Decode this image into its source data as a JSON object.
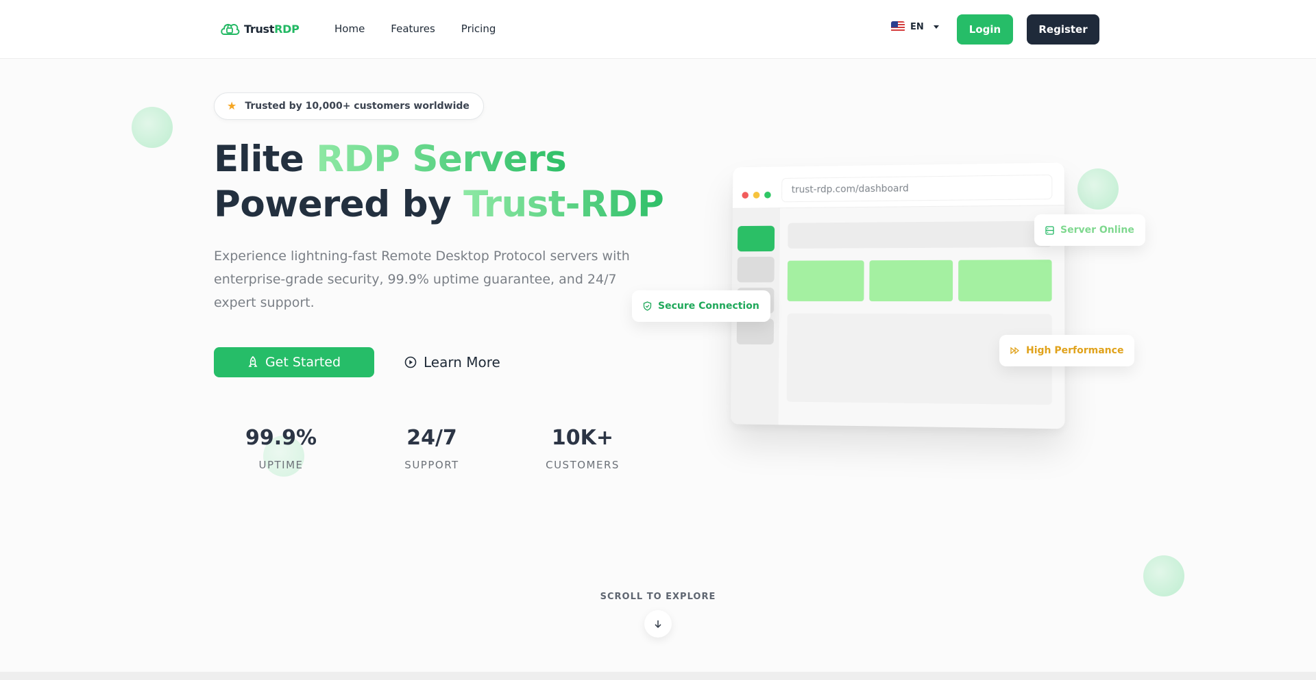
{
  "nav": {
    "logo": {
      "part1": "Trust",
      "part2": "RDP"
    },
    "links": [
      "Home",
      "Features",
      "Pricing"
    ],
    "language": {
      "code": "EN",
      "flag_icon": "us-flag-icon"
    },
    "login_label": "Login",
    "register_label": "Register"
  },
  "hero": {
    "badge": "Trusted by 10,000+ customers worldwide",
    "title": {
      "line1_plain": "Elite ",
      "line1_accent": "RDP Servers",
      "line2_plain": "Powered by ",
      "line2_accent": "Trust-RDP"
    },
    "subtitle": "Experience lightning-fast Remote Desktop Protocol servers with enterprise-grade security, 99.9% uptime guarantee, and 24/7 expert support.",
    "cta_primary": "Get Started",
    "cta_secondary": "Learn More",
    "stats": [
      {
        "value": "99.9%",
        "label": "UPTIME"
      },
      {
        "value": "24/7",
        "label": "SUPPORT"
      },
      {
        "value": "10K+",
        "label": "CUSTOMERS"
      }
    ]
  },
  "mockup": {
    "url": "trust-rdp.com/dashboard",
    "chips": {
      "server": "Server Online",
      "secure": "Secure Connection",
      "performance": "High Performance"
    }
  },
  "scroll": {
    "label": "SCROLL TO EXPLORE"
  },
  "colors": {
    "brand_green": "#26bd68",
    "dark_navy": "#1f2a3a",
    "accent_yellow": "#e0a21b"
  }
}
